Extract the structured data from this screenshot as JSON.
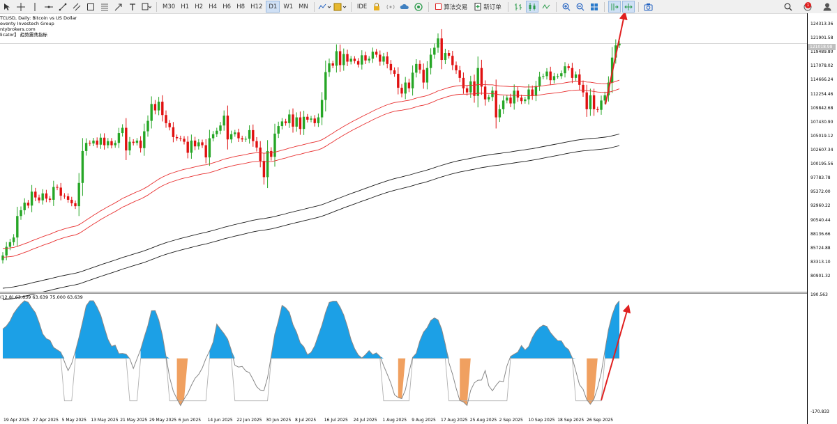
{
  "toolbar": {
    "timeframes": [
      "M30",
      "H1",
      "H2",
      "H4",
      "H6",
      "H8",
      "H12",
      "D1",
      "W1",
      "MN"
    ],
    "active_timeframe": "D1",
    "ide_label": "IDE",
    "algo_trading_label": "算法交易",
    "new_order_label": "新订单",
    "notification_count": "1"
  },
  "chart": {
    "symbol_line": "TCUSD, Daily:  Bitcoin vs US Dollar",
    "broker_line": "eventy Investech Group",
    "site_line": "ntybrokers.com",
    "indicator_line": "licator】 趋势震荡指标",
    "current_price": "121018.98",
    "price_axis": [
      "124313.36",
      "121901.58",
      "119489.80",
      "117078.02",
      "114666.24",
      "112254.46",
      "109842.68",
      "107430.90",
      "105019.12",
      "102607.34",
      "100195.56",
      "97783.78",
      "95372.00",
      "92960.22",
      "90540.44",
      "88136.66",
      "85724.88",
      "83313.10",
      "80901.32"
    ],
    "oscillator_info": "(12,8) 63.639 63.639 75.000 63.639",
    "oscillator_axis": [
      "190.563",
      "-170.833"
    ],
    "dates": [
      "19 Apr 2025",
      "27 Apr 2025",
      "5 May 2025",
      "13 May 2025",
      "21 May 2025",
      "29 May 2025",
      "6 Jun 2025",
      "14 Jun 2025",
      "22 Jun 2025",
      "30 Jun 2025",
      "8 Jul 2025",
      "16 Jul 2025",
      "24 Jul 2025",
      "1 Aug 2025",
      "9 Aug 2025",
      "17 Aug 2025",
      "25 Aug 2025",
      "2 Sep 2025",
      "10 Sep 2025",
      "18 Sep 2025",
      "26 Sep 2025"
    ],
    "colors": {
      "bull": "#26a626",
      "bear": "#e01010",
      "ma_red": "#e83030",
      "ma_black": "#1a1a1a",
      "osc_blue": "#1ca0e6",
      "osc_orange": "#f0a060",
      "arrow": "#e02020"
    },
    "closes": [
      84500,
      86000,
      86800,
      87600,
      91300,
      92300,
      93600,
      93100,
      95500,
      94500,
      94000,
      95200,
      94300,
      94100,
      96300,
      96200,
      94800,
      94700,
      94100,
      93500,
      93000,
      97000,
      102500,
      103900,
      103800,
      104300,
      103600,
      104800,
      103500,
      104200,
      103500,
      103900,
      105600,
      106500,
      102600,
      104100,
      103900,
      104300,
      103000,
      105900,
      107700,
      110600,
      109500,
      111000,
      108700,
      107300,
      106600,
      104900,
      104700,
      104600,
      104100,
      102200,
      104300,
      103300,
      104000,
      103500,
      101400,
      104700,
      105400,
      106000,
      106900,
      108600,
      104500,
      105400,
      105700,
      104700,
      104500,
      104600,
      106100,
      104200,
      103100,
      100800,
      98000,
      102500,
      101500,
      105500,
      106800,
      107600,
      107300,
      108800,
      106700,
      108300,
      106300,
      108400,
      107900,
      108100,
      107300,
      108300,
      111300,
      116100,
      117600,
      117200,
      119700,
      117300,
      119200,
      117900,
      118400,
      118000,
      117400,
      119000,
      118100,
      118400,
      119600,
      119100,
      117900,
      118800,
      117500,
      116400,
      115800,
      113400,
      112400,
      114300,
      113300,
      116000,
      117500,
      116500,
      114300,
      116800,
      119100,
      120300,
      121900,
      118200,
      119400,
      118900,
      117300,
      116400,
      115100,
      113300,
      112600,
      114500,
      112000,
      116800,
      113600,
      111400,
      111800,
      112900,
      108300,
      109700,
      111200,
      111700,
      110700,
      112900,
      111700,
      111100,
      111400,
      113100,
      112000,
      113700,
      115300,
      115400,
      116200,
      114700,
      115400,
      115400,
      115900,
      117100,
      116800,
      115100,
      115700,
      113900,
      112600,
      109700,
      112100,
      109700,
      109600,
      111200,
      112100,
      114300,
      118600,
      120700,
      121000
    ],
    "y_axis_range": [
      78500,
      126000
    ],
    "oscillator_range": [
      -170.833,
      190.563
    ]
  }
}
